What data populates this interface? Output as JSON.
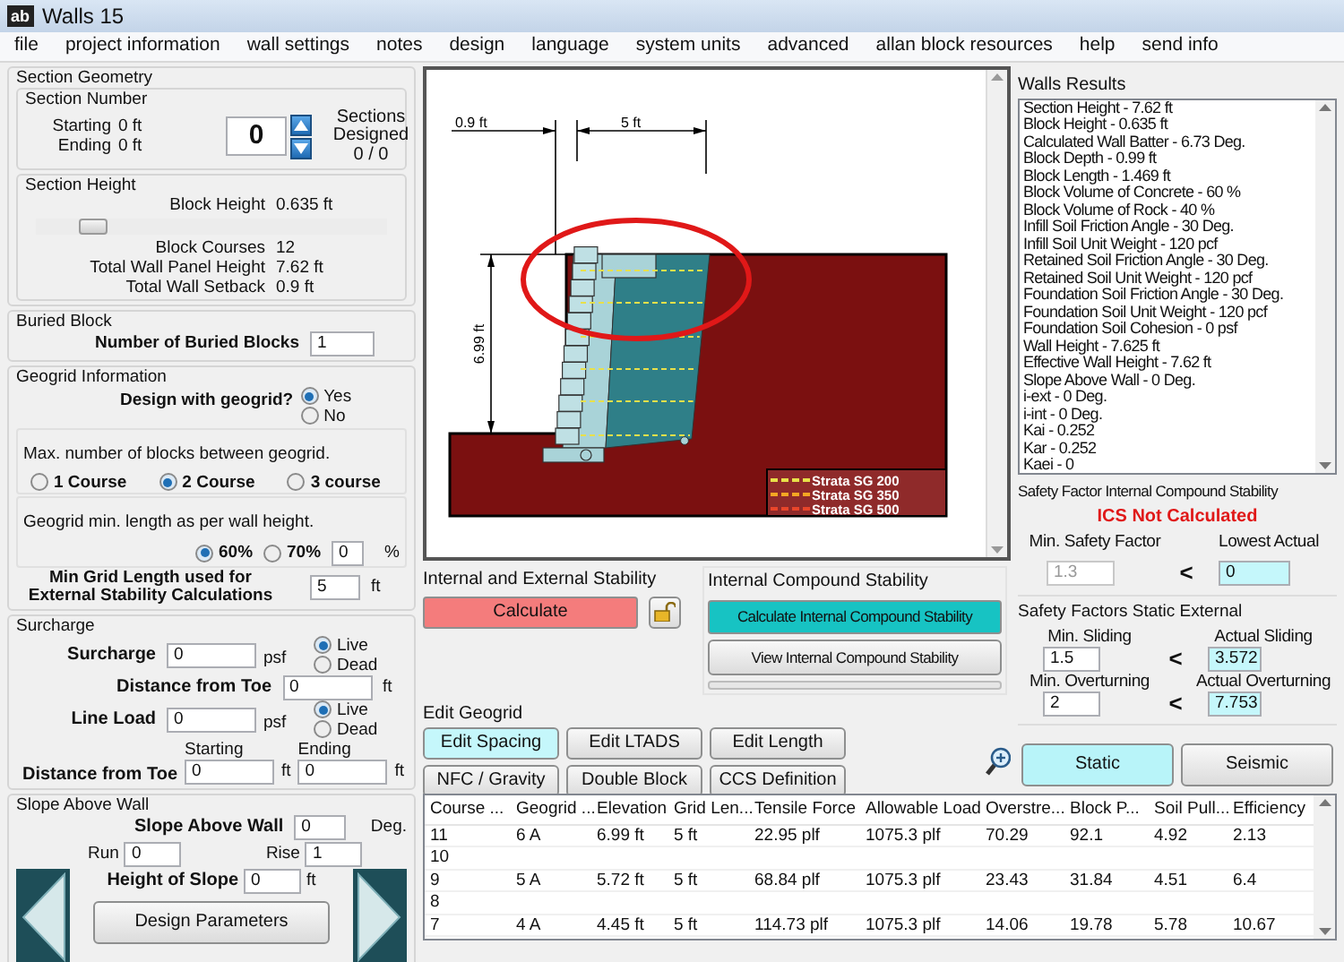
{
  "window": {
    "title": "Walls 15",
    "icon_text": "ab"
  },
  "menu": [
    "file",
    "project information",
    "wall settings",
    "notes",
    "design",
    "language",
    "system units",
    "advanced",
    "allan block resources",
    "help",
    "send info"
  ],
  "section_geometry": {
    "title": "Section Geometry",
    "section_number": {
      "title": "Section Number",
      "starting_label": "Starting",
      "starting_value": "0 ft",
      "ending_label": "Ending",
      "ending_value": "0 ft",
      "spinner_value": "0",
      "designed_label": "Sections Designed",
      "designed_value": "0 / 0"
    },
    "section_height": {
      "title": "Section Height",
      "block_height_label": "Block Height",
      "block_height_value": "0.635 ft",
      "slider": {
        "level": 0.12
      },
      "rows": [
        {
          "label": "Block Courses",
          "value": "12"
        },
        {
          "label": "Total Wall Panel Height",
          "value": "7.62 ft"
        },
        {
          "label": "Total Wall Setback",
          "value": "0.9 ft"
        }
      ]
    }
  },
  "buried_block": {
    "title": "Buried Block",
    "label": "Number of Buried Blocks",
    "value": "1"
  },
  "geogrid": {
    "title": "Geogrid Information",
    "design_label": "Design with geogrid?",
    "design_options": [
      {
        "label": "Yes",
        "selected": true
      },
      {
        "label": "No",
        "selected": false
      }
    ],
    "max_blocks_label": "Max. number of blocks between geogrid.",
    "course_options": [
      {
        "label": "1 Course",
        "selected": false
      },
      {
        "label": "2 Course",
        "selected": true
      },
      {
        "label": "3 course",
        "selected": false
      }
    ],
    "min_length_label": "Geogrid min. length as per wall height.",
    "percent_options": [
      {
        "label": "60%",
        "selected": true
      },
      {
        "label": "70%",
        "selected": false
      }
    ],
    "percent_value": "0",
    "percent_unit": "%",
    "min_grid_label": "Min Grid Length used for External Stability Calculations",
    "min_grid_value": "5",
    "min_grid_unit": "ft"
  },
  "surcharge": {
    "title": "Surcharge",
    "surcharge_label": "Surcharge",
    "surcharge_value": "0",
    "surcharge_unit": "psf",
    "surcharge_options": [
      {
        "label": "Live",
        "selected": true
      },
      {
        "label": "Dead",
        "selected": false
      }
    ],
    "distance_label": "Distance from Toe",
    "distance_value": "0",
    "distance_unit": "ft",
    "line_load_label": "Line Load",
    "line_load_value": "0",
    "line_load_unit": "psf",
    "line_load_options": [
      {
        "label": "Live",
        "selected": true
      },
      {
        "label": "Dead",
        "selected": false
      }
    ],
    "range_label": "Distance from Toe",
    "starting_label": "Starting",
    "starting_value": "0",
    "starting_unit": "ft",
    "ending_label": "Ending",
    "ending_value": "0",
    "ending_unit": "ft"
  },
  "slope": {
    "title": "Slope Above Wall",
    "slope_label": "Slope Above Wall",
    "slope_value": "0",
    "slope_unit": "Deg.",
    "run_label": "Run",
    "run_value": "0",
    "rise_label": "Rise",
    "rise_value": "1",
    "height_label": "Height of Slope",
    "height_value": "0",
    "height_unit": "ft"
  },
  "design_parameters_button": "Design Parameters",
  "drawing": {
    "setback_label": "0.9 ft",
    "grid_length_label": "5 ft",
    "height_label": "6.99 ft",
    "legend": [
      {
        "label": "Strata SG 200",
        "color": "#e8e04a"
      },
      {
        "label": "Strata SG 350",
        "color": "#f5a623"
      },
      {
        "label": "Strata SG 500",
        "color": "#e8452a"
      }
    ]
  },
  "stability": {
    "title": "Internal and External Stability",
    "calculate_button": "Calculate"
  },
  "ics": {
    "title": "Internal Compound Stability",
    "calculate_button": "Calculate Internal Compound Stability",
    "view_button": "View Internal Compound Stability",
    "progress": {
      "level": 0
    }
  },
  "edit_geogrid": {
    "title": "Edit Geogrid",
    "buttons": [
      {
        "label": "Edit Spacing",
        "selected": true
      },
      {
        "label": "Edit LTADS",
        "selected": false
      },
      {
        "label": "Edit Length",
        "selected": false
      },
      {
        "label": "NFC / Gravity",
        "selected": false
      },
      {
        "label": "Double Block",
        "selected": false
      },
      {
        "label": "CCS Definition",
        "selected": false
      }
    ]
  },
  "results": {
    "title": "Walls Results",
    "items": [
      "Section Height - 7.62 ft",
      "Block Height - 0.635 ft",
      "Calculated Wall Batter - 6.73 Deg.",
      "Block Depth - 0.99 ft",
      "Block Length - 1.469 ft",
      "Block Volume of Concrete - 60 %",
      "Block Volume of Rock - 40 %",
      "Infill Soil Friction Angle - 30 Deg.",
      "Infill Soil Unit Weight - 120 pcf",
      "Retained Soil Friction Angle - 30 Deg.",
      "Retained Soil Unit Weight - 120  pcf",
      "Foundation Soil Friction Angle - 30 Deg.",
      "Foundation Soil Unit Weight - 120 pcf",
      "Foundation Soil Cohesion - 0 psf",
      "Wall Height - 7.625 ft",
      "Effective Wall Height - 7.62 ft",
      "Slope Above Wall - 0 Deg.",
      "i-ext - 0 Deg.",
      "i-int - 0 Deg.",
      "Kai - 0.252",
      "Kar - 0.252",
      "Kaei - 0"
    ]
  },
  "ics_safety": {
    "title": "Safety Factor Internal Compound Stability",
    "status": "ICS Not Calculated",
    "min_label": "Min. Safety Factor",
    "min_value": "1.3",
    "min_disabled": true,
    "compare": "<",
    "actual_label": "Lowest Actual",
    "actual_value": "0"
  },
  "static_safety": {
    "title": "Safety Factors Static External",
    "rows": [
      {
        "min_label": "Min. Sliding",
        "min_value": "1.5",
        "compare": "<",
        "actual_label": "Actual Sliding",
        "actual_value": "3.572"
      },
      {
        "min_label": "Min. Overturning",
        "min_value": "2",
        "compare": "<",
        "actual_label": "Actual Overturning",
        "actual_value": "7.753"
      }
    ]
  },
  "mode_buttons": [
    {
      "label": "Static",
      "selected": true
    },
    {
      "label": "Seismic",
      "selected": false
    }
  ],
  "table": {
    "columns": [
      "Course ...",
      "Geogrid ...",
      "Elevation",
      "Grid Len...",
      "Tensile Force",
      "Allowable Load",
      "Overstre...",
      "Block P...",
      "Soil Pull...",
      "Efficiency"
    ],
    "rows": [
      [
        "11",
        "6 A",
        "6.99 ft",
        "5 ft",
        "22.95 plf",
        "1075.3 plf",
        "70.29",
        "92.1",
        "4.92",
        "2.13"
      ],
      [
        "10"
      ],
      [
        "9",
        "5 A",
        "5.72 ft",
        "5 ft",
        "68.84 plf",
        "1075.3 plf",
        "23.43",
        "31.84",
        "4.51",
        "6.4"
      ],
      [
        "8"
      ],
      [
        "7",
        "4 A",
        "4.45 ft",
        "5 ft",
        "114.73 plf",
        "1075.3 plf",
        "14.06",
        "19.78",
        "5.78",
        "10.67"
      ]
    ]
  }
}
